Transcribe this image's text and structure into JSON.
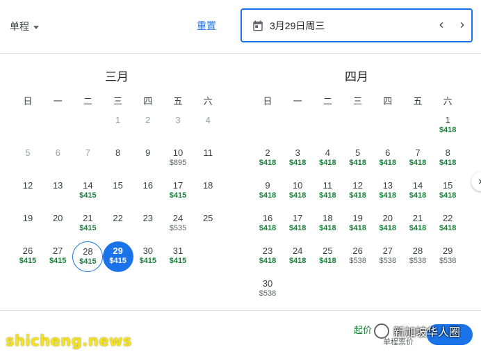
{
  "header": {
    "trip_type": "单程",
    "reset": "重置",
    "selected_date": "3月29日周三"
  },
  "weekdays": [
    "日",
    "一",
    "二",
    "三",
    "四",
    "五",
    "六"
  ],
  "months": [
    {
      "title": "三月",
      "lead_blanks": 3,
      "days": [
        {
          "d": "1",
          "p": "",
          "disabled": true
        },
        {
          "d": "2",
          "p": "",
          "disabled": true
        },
        {
          "d": "3",
          "p": "",
          "disabled": true
        },
        {
          "d": "4",
          "p": "",
          "disabled": true
        },
        {
          "d": "5",
          "p": "",
          "disabled": true
        },
        {
          "d": "6",
          "p": "",
          "disabled": true
        },
        {
          "d": "7",
          "p": "",
          "disabled": true
        },
        {
          "d": "8",
          "p": ""
        },
        {
          "d": "9",
          "p": ""
        },
        {
          "d": "10",
          "p": "$895",
          "gray": true
        },
        {
          "d": "11",
          "p": ""
        },
        {
          "d": "12",
          "p": ""
        },
        {
          "d": "13",
          "p": ""
        },
        {
          "d": "14",
          "p": "$415"
        },
        {
          "d": "15",
          "p": ""
        },
        {
          "d": "16",
          "p": ""
        },
        {
          "d": "17",
          "p": "$415"
        },
        {
          "d": "18",
          "p": ""
        },
        {
          "d": "19",
          "p": ""
        },
        {
          "d": "20",
          "p": ""
        },
        {
          "d": "21",
          "p": "$415"
        },
        {
          "d": "22",
          "p": ""
        },
        {
          "d": "23",
          "p": ""
        },
        {
          "d": "24",
          "p": "$535",
          "gray": true
        },
        {
          "d": "25",
          "p": ""
        },
        {
          "d": "26",
          "p": "$415"
        },
        {
          "d": "27",
          "p": "$415"
        },
        {
          "d": "28",
          "p": "$415",
          "start": true
        },
        {
          "d": "29",
          "p": "$415",
          "selected": true
        },
        {
          "d": "30",
          "p": "$415"
        },
        {
          "d": "31",
          "p": "$415"
        }
      ]
    },
    {
      "title": "四月",
      "lead_blanks": 6,
      "days": [
        {
          "d": "1",
          "p": "$418"
        },
        {
          "d": "2",
          "p": "$418"
        },
        {
          "d": "3",
          "p": "$418"
        },
        {
          "d": "4",
          "p": "$418"
        },
        {
          "d": "5",
          "p": "$418"
        },
        {
          "d": "6",
          "p": "$418"
        },
        {
          "d": "7",
          "p": "$418"
        },
        {
          "d": "8",
          "p": "$418"
        },
        {
          "d": "9",
          "p": "$418"
        },
        {
          "d": "10",
          "p": "$418"
        },
        {
          "d": "11",
          "p": "$418"
        },
        {
          "d": "12",
          "p": "$418"
        },
        {
          "d": "13",
          "p": "$418"
        },
        {
          "d": "14",
          "p": "$418"
        },
        {
          "d": "15",
          "p": "$418"
        },
        {
          "d": "16",
          "p": "$418"
        },
        {
          "d": "17",
          "p": "$418"
        },
        {
          "d": "18",
          "p": "$418"
        },
        {
          "d": "19",
          "p": "$418"
        },
        {
          "d": "20",
          "p": "$418"
        },
        {
          "d": "21",
          "p": "$418"
        },
        {
          "d": "22",
          "p": "$418"
        },
        {
          "d": "23",
          "p": "$418"
        },
        {
          "d": "24",
          "p": "$418"
        },
        {
          "d": "25",
          "p": "$418"
        },
        {
          "d": "26",
          "p": "$538",
          "gray": true
        },
        {
          "d": "27",
          "p": "$538",
          "gray": true
        },
        {
          "d": "28",
          "p": "$538",
          "gray": true
        },
        {
          "d": "29",
          "p": "$538",
          "gray": true
        },
        {
          "d": "30",
          "p": "$538",
          "gray": true
        }
      ]
    }
  ],
  "footer": {
    "price_label": "起价",
    "sub_label": "单程票价"
  },
  "watermarks": {
    "left": "shicheng.news",
    "right": "新加坡华人圈"
  },
  "colors": {
    "accent": "#1a73e8",
    "price_green": "#188038",
    "price_gray": "#5f6368"
  },
  "icons": {
    "date_field": "calendar-icon",
    "prev": "chevron-left-icon",
    "next": "chevron-right-icon",
    "side": "chevron-right-icon",
    "trip_type": "caret-down-icon"
  }
}
